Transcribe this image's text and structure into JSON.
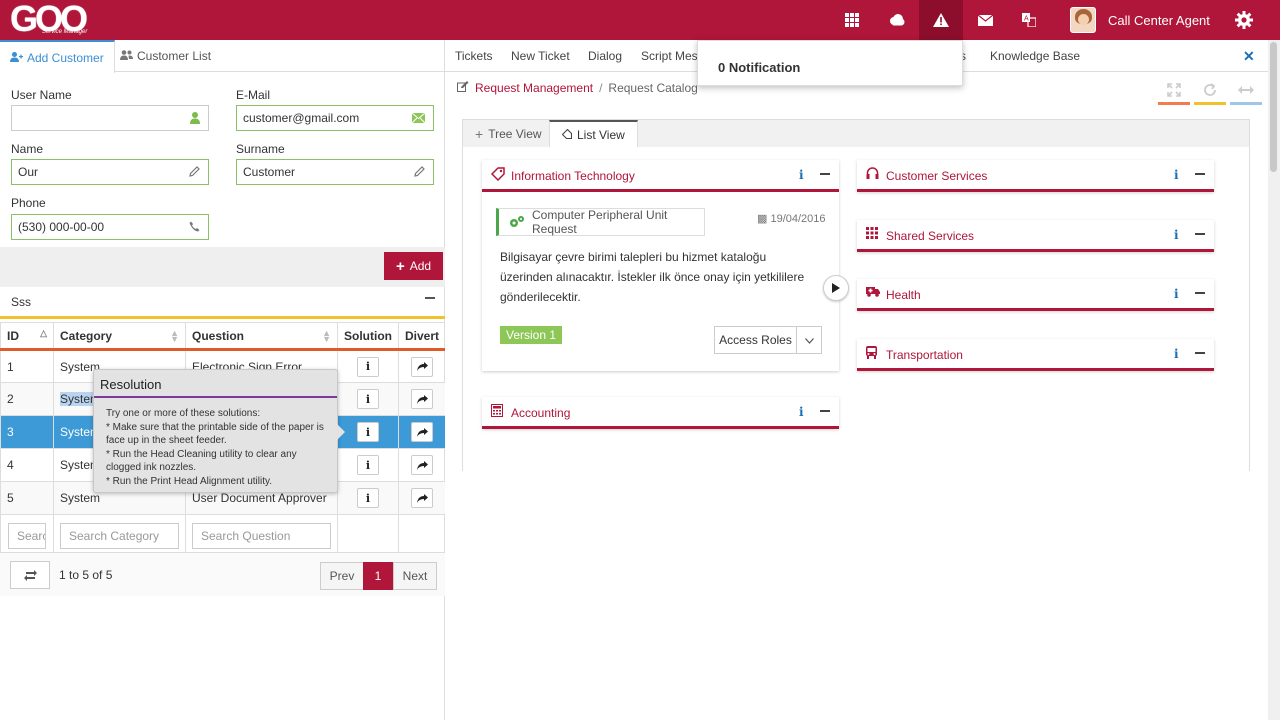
{
  "app": {
    "logo_text": "GOO",
    "logo_subtitle": "Service Manager",
    "user_name": "Call Center Agent",
    "top_icons": [
      "apps-grid-icon",
      "cloud-icon",
      "warning-icon",
      "mail-icon",
      "translate-icon"
    ]
  },
  "notification": {
    "label": "0 Notification"
  },
  "left_tabs": [
    {
      "label": "Add Customer",
      "active": true
    },
    {
      "label": "Customer List",
      "active": false
    }
  ],
  "form": {
    "user_name_label": "User Name",
    "user_name_value": "",
    "email_label": "E-Mail",
    "email_value": "customer@gmail.com",
    "name_label": "Name",
    "name_value": "Our",
    "surname_label": "Surname",
    "surname_value": "Customer",
    "phone_label": "Phone",
    "phone_value": "(530) 000-00-00",
    "add_button": "Add"
  },
  "sss": {
    "title": "Sss",
    "columns": [
      "ID",
      "Category",
      "Question",
      "Solution",
      "Divert"
    ],
    "rows": [
      {
        "id": "1",
        "category": "System",
        "question": "Electronic Sign Error"
      },
      {
        "id": "2",
        "category": "System",
        "question": ""
      },
      {
        "id": "3",
        "category": "System",
        "question": ""
      },
      {
        "id": "4",
        "category": "System",
        "question": ""
      },
      {
        "id": "5",
        "category": "System",
        "question": "User Document Approver"
      }
    ],
    "selected_row": 3,
    "search_id_placeholder": "Search ID",
    "search_category_placeholder": "Search Category",
    "search_question_placeholder": "Search Question",
    "pager_info": "1 to 5 of 5",
    "prev": "Prev",
    "page": "1",
    "next": "Next"
  },
  "tooltip": {
    "title": "Resolution",
    "lines": [
      "Try one or more of these solutions:",
      "* Make sure that the printable side of the paper is face up in the sheet feeder.",
      "* Run the Head Cleaning utility to clear any clogged ink nozzles.",
      "* Run the Print Head Alignment utility."
    ]
  },
  "right_tabs": [
    "Tickets",
    "New Ticket",
    "Dialog",
    "Script Mess",
    "s",
    "Knowledge Base"
  ],
  "breadcrumb": {
    "link": "Request Management",
    "separator": "/",
    "current": "Request Catalog"
  },
  "toolbar_colors": [
    "#f07c50",
    "#f0c22b",
    "#9ec6e8"
  ],
  "view_tabs": [
    {
      "label": "Tree View",
      "active": false
    },
    {
      "label": "List View",
      "active": true
    }
  ],
  "categories": {
    "it": {
      "title": "Information Technology",
      "request_title": "Computer Peripheral Unit Request",
      "date": "19/04/2016",
      "description": "Bilgisayar çevre birimi talepleri bu hizmet kataloğu üzerinden alınacaktır. İstekler ilk önce onay için yetkililere gönderilecektir.",
      "version": "Version 1",
      "access_roles": "Access Roles"
    },
    "accounting": "Accounting",
    "customer_services": "Customer Services",
    "shared_services": "Shared Services",
    "health": "Health",
    "transportation": "Transportation"
  },
  "colors": {
    "brand": "#b0153a",
    "selected_row": "#3d9ad6",
    "info": "#1a6fb5",
    "version": "#8cc757"
  }
}
